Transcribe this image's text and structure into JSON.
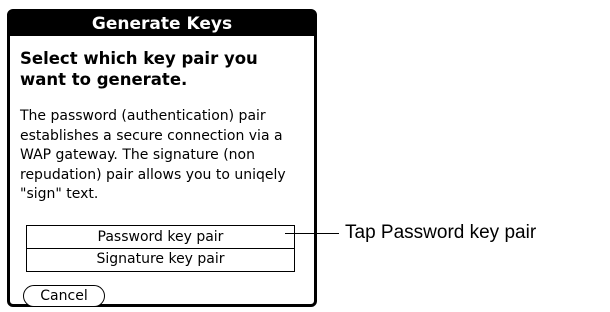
{
  "dialog": {
    "title": "Generate Keys",
    "heading": "Select which key pair you want to generate.",
    "body": "The password (authentication) pair establishes a secure connection via a WAP gateway. The signature (non repudation) pair allows you to uniqely \"sign\" text.",
    "options": [
      {
        "label": "Password key pair"
      },
      {
        "label": "Signature key pair"
      }
    ],
    "cancel_label": "Cancel"
  },
  "callout": {
    "label": "Tap Password key pair"
  }
}
